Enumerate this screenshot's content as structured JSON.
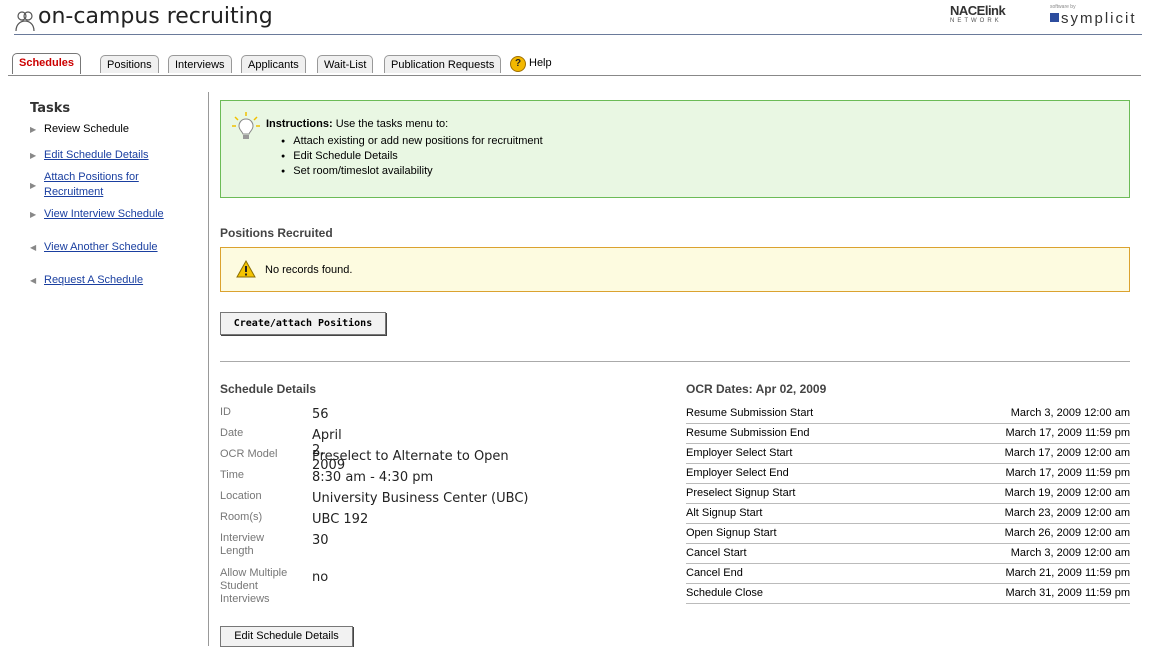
{
  "header": {
    "app_title": "on-campus recruiting",
    "logo_nace_top": "NACElink",
    "logo_nace_bottom": "NETWORK",
    "logo_symplicity_small": "software by",
    "logo_symplicity": "symplicit"
  },
  "tabs": [
    "Schedules",
    "Positions",
    "Interviews",
    "Applicants",
    "Wait-List",
    "Publication Requests"
  ],
  "help_label": "Help",
  "sidebar": {
    "title": "Tasks",
    "items": [
      {
        "label": "Review Schedule"
      },
      {
        "label": "Edit Schedule Details"
      },
      {
        "label": "Attach Positions for Recruitment"
      },
      {
        "label": "View Interview Schedule"
      },
      {
        "label": "View Another Schedule"
      },
      {
        "label": "Request A Schedule"
      }
    ]
  },
  "instructions": {
    "label": "Instructions:",
    "intro": "Use the tasks menu to:",
    "items": [
      "Attach existing or add new positions for recruitment",
      "Edit Schedule Details",
      "Set room/timeslot availability"
    ]
  },
  "positions": {
    "title": "Positions Recruited",
    "empty_message": "No records found.",
    "create_button": "Create/attach Positions"
  },
  "schedule_details": {
    "title": "Schedule Details",
    "rows": [
      {
        "label": "ID",
        "value": "56"
      },
      {
        "label": "Date",
        "value": "April 2, 2009"
      },
      {
        "label": "OCR Model",
        "value": "Preselect to Alternate to Open"
      },
      {
        "label": "Time",
        "value": "8:30 am - 4:30 pm"
      },
      {
        "label": "Location",
        "value": "University Business Center (UBC)"
      },
      {
        "label": "Room(s)",
        "value": "UBC 192"
      },
      {
        "label": "Interview Length",
        "value": "30"
      },
      {
        "label": "Allow Multiple Student Interviews",
        "value": "no"
      }
    ],
    "edit_button": "Edit Schedule Details"
  },
  "ocr_dates": {
    "title": "OCR Dates: Apr 02, 2009",
    "rows": [
      {
        "label": "Resume Submission Start",
        "value": "March 3, 2009 12:00 am"
      },
      {
        "label": "Resume Submission End",
        "value": "March 17, 2009 11:59 pm"
      },
      {
        "label": "Employer Select Start",
        "value": "March 17, 2009 12:00 am"
      },
      {
        "label": "Employer Select End",
        "value": "March 17, 2009 11:59 pm"
      },
      {
        "label": "Preselect Signup Start",
        "value": "March 19, 2009 12:00 am"
      },
      {
        "label": "Alt Signup Start",
        "value": "March 23, 2009 12:00 am"
      },
      {
        "label": "Open Signup Start",
        "value": "March 26, 2009 12:00 am"
      },
      {
        "label": "Cancel Start",
        "value": "March 3, 2009 12:00 am"
      },
      {
        "label": "Cancel End",
        "value": "March 21, 2009 11:59 pm"
      },
      {
        "label": "Schedule Close",
        "value": "March 31, 2009 11:59 pm"
      }
    ]
  },
  "colors": {
    "active_tab": "#cc0000",
    "link": "#1a3fa0",
    "instructions_bg": "#e9f7e3",
    "instructions_border": "#6cbb57",
    "warning_bg": "#fdfbe0",
    "warning_border": "#dba22f"
  }
}
